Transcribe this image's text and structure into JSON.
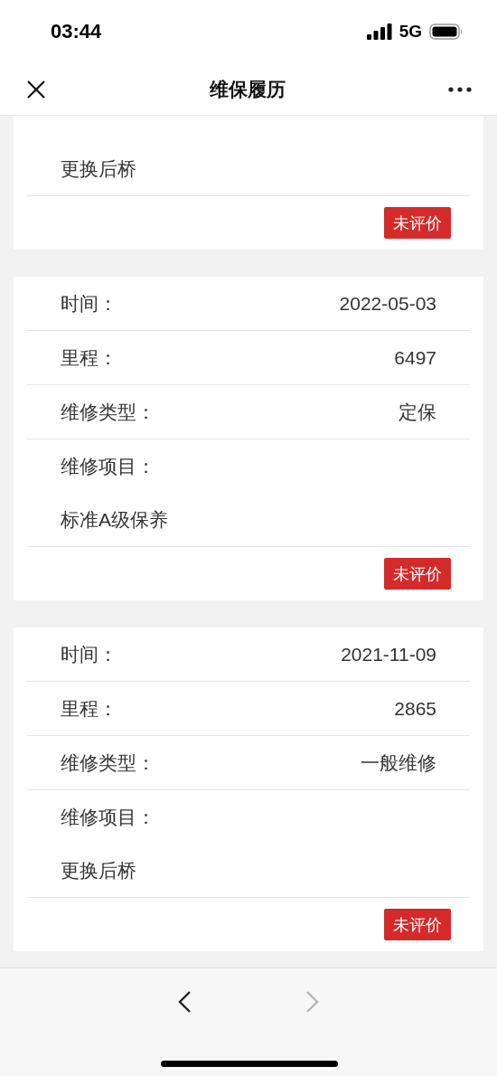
{
  "status_bar": {
    "time": "03:44",
    "network": "5G"
  },
  "header": {
    "title": "维保履历"
  },
  "records": [
    {
      "items": "更换后桥",
      "rating": "未评价"
    },
    {
      "rows": [
        {
          "label": "时间：",
          "value": "2022-05-03"
        },
        {
          "label": "里程：",
          "value": "6497"
        },
        {
          "label": "维修类型：",
          "value": "定保"
        }
      ],
      "items_label": "维修项目：",
      "items": "标准A级保养",
      "rating": "未评价"
    },
    {
      "rows": [
        {
          "label": "时间：",
          "value": "2021-11-09"
        },
        {
          "label": "里程：",
          "value": "2865"
        },
        {
          "label": "维修类型：",
          "value": "一般维修"
        }
      ],
      "items_label": "维修项目：",
      "items": "更换后桥",
      "rating": "未评价"
    }
  ],
  "toolbar": {
    "back": {
      "disabled": false
    },
    "forward": {
      "disabled": true
    }
  }
}
